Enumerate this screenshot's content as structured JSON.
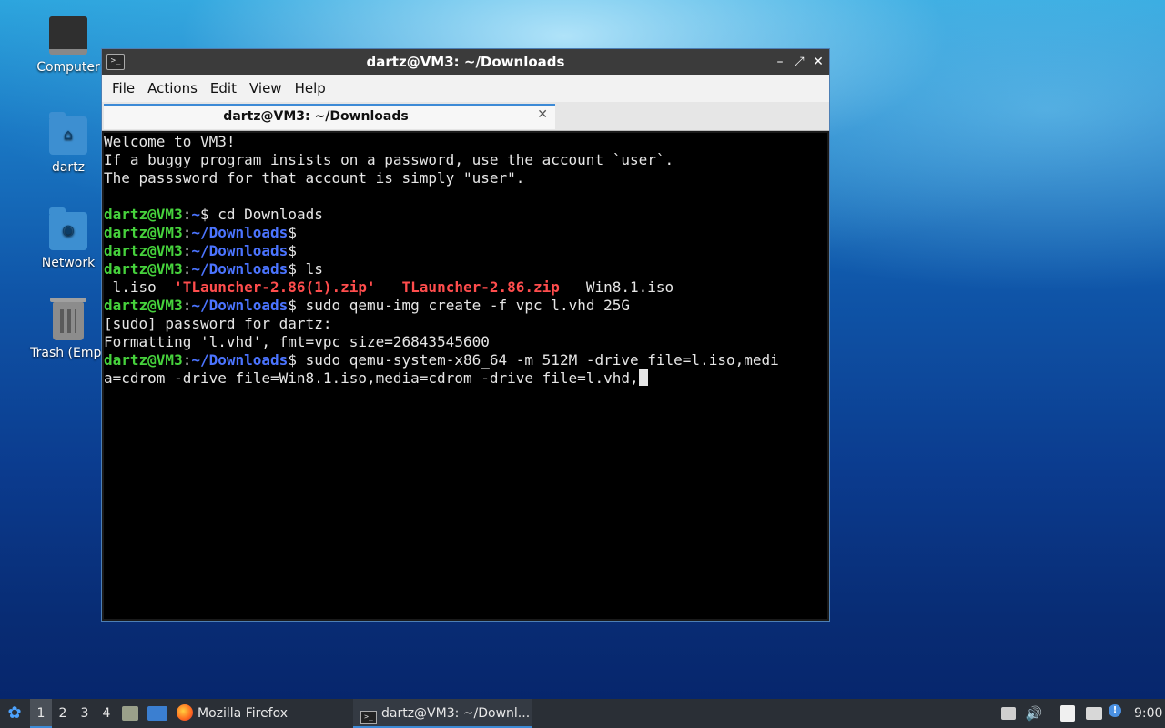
{
  "desktop": {
    "icons": [
      {
        "label": "Computer",
        "icon": "monitor-icon"
      },
      {
        "label": "dartz",
        "icon": "home-folder-icon"
      },
      {
        "label": "Network",
        "icon": "network-folder-icon"
      },
      {
        "label": "Trash (Empt",
        "icon": "trash-icon"
      }
    ]
  },
  "window": {
    "title": "dartz@VM3: ~/Downloads",
    "menu": [
      "File",
      "Actions",
      "Edit",
      "View",
      "Help"
    ],
    "tab_label": "dartz@VM3: ~/Downloads",
    "controls": {
      "minimize": "–",
      "maximize": "⤢",
      "close": "✕"
    }
  },
  "terminal": {
    "line1": "Welcome to VM3!",
    "line2": "If a buggy program insists on a password, use the account `user`.",
    "line3": "The passsword for that account is simply \"user\".",
    "user_host": "dartz@VM3",
    "home_path": "~",
    "dl_path": "~/Downloads",
    "cmd1": " cd Downloads",
    "cmd4": " ls",
    "ls_iso": " l.iso  ",
    "ls_zip1": "'TLauncher-2.86(1).zip'",
    "ls_zip2": "TLauncher-2.86.zip",
    "ls_win": "   Win8.1.iso",
    "cmd5": " sudo qemu-img create -f vpc l.vhd 25G",
    "sudo_prompt": "[sudo] password for dartz:",
    "format_out": "Formatting 'l.vhd', fmt=vpc size=26843545600",
    "cmd6a": " sudo qemu-system-x86_64 -m 512M -drive file=l.iso,medi",
    "cmd6b": "a=cdrom -drive file=Win8.1.iso,media=cdrom -drive file=l.vhd,"
  },
  "taskbar": {
    "workspaces": [
      "1",
      "2",
      "3",
      "4"
    ],
    "active_workspace": "1",
    "firefox_label": "Mozilla Firefox",
    "terminal_task_label": "dartz@VM3: ~/Downl...",
    "clock": "9:00"
  }
}
